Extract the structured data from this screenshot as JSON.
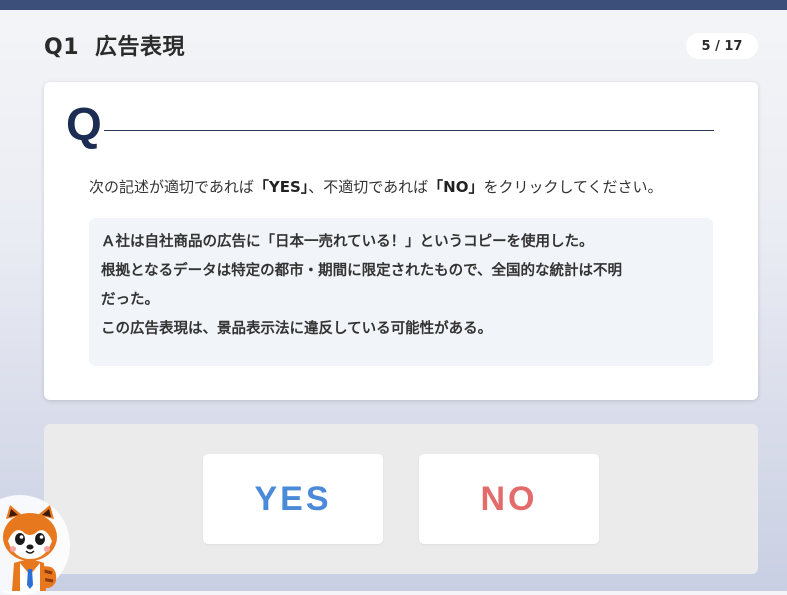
{
  "header": {
    "question_number": "Q1",
    "category": "広告表現",
    "progress": "5 / 17"
  },
  "question": {
    "mark": "Q",
    "instruction_pre": "次の記述が適切であれば",
    "yes_quote": "「YES」",
    "instruction_mid": "、不適切であれば",
    "no_quote": "「NO」",
    "instruction_post": "をクリックしてください。",
    "statement_lines": [
      "Ａ社は自社商品の広告に「日本一売れている！」というコピーを使用した。",
      "根拠となるデータは特定の都市・期間に限定されたもので、全国的な統計は不明",
      "だった。",
      "この広告表現は、景品表示法に違反している可能性がある。"
    ]
  },
  "answers": {
    "yes_label": "YES",
    "no_label": "NO"
  },
  "colors": {
    "topbar": "#3b4f7a",
    "yes": "#4a8ad8",
    "no": "#e36b6b",
    "q_mark": "#1c2c52"
  },
  "icons": {
    "mascot": "red-panda-mascot-icon"
  }
}
